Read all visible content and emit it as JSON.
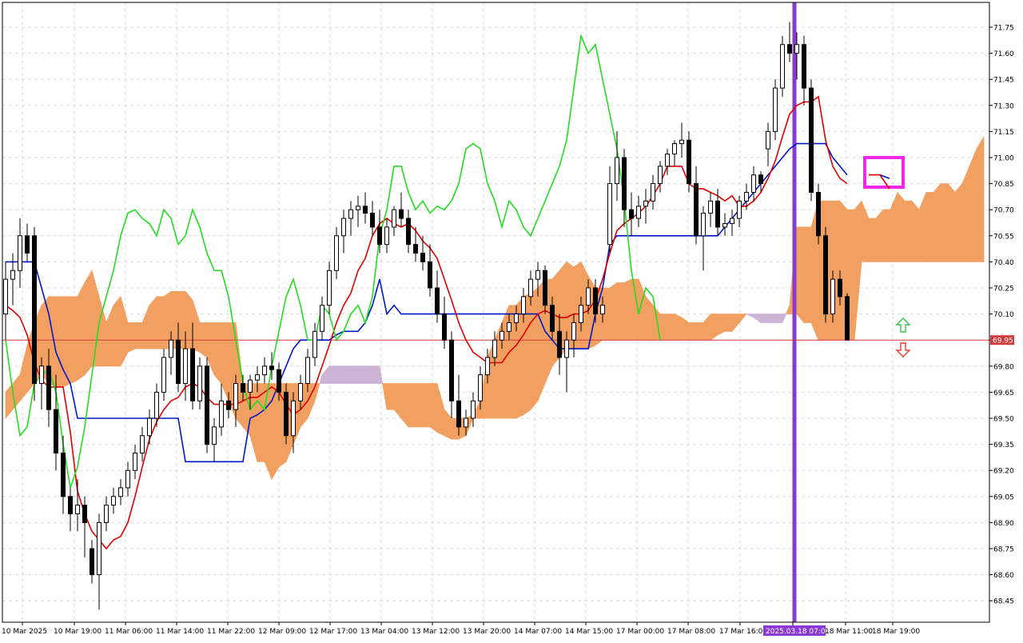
{
  "chart_data": {
    "type": "candlestick",
    "y_axis": {
      "ticks": [
        "71.75",
        "71.60",
        "71.45",
        "71.30",
        "71.15",
        "71.00",
        "70.85",
        "70.70",
        "70.55",
        "70.40",
        "70.25",
        "70.10",
        "69.95",
        "69.80",
        "69.65",
        "69.50",
        "69.35",
        "69.20",
        "69.05",
        "68.90",
        "68.75",
        "68.60",
        "68.45"
      ]
    },
    "x_axis": {
      "labels": [
        "10 Mar 2025",
        "10 Mar 19:00",
        "11 Mar 06:00",
        "11 Mar 14:00",
        "11 Mar 22:00",
        "12 Mar 09:00",
        "12 Mar 17:00",
        "13 Mar 04:00",
        "13 Mar 12:00",
        "13 Mar 20:00",
        "14 Mar 07:00",
        "14 Mar 15:00",
        "17 Mar 00:00",
        "17 Mar 08:00",
        "17 Mar 16:00",
        "2025.03.18 07:00",
        "18 Mar 11:00",
        "18 Mar 19:00"
      ]
    },
    "current_price": {
      "label": "69.95",
      "value": 69.95,
      "color": "#d23c3c"
    },
    "vertical_marker": {
      "label": "2025.03.18 07:00",
      "color": "#8a3ad4"
    },
    "colors": {
      "bull_body": "#ffffff",
      "bear_body": "#000000",
      "wick": "#000000",
      "tenkan": "#e00000",
      "kijun": "#0018c8",
      "chikou": "#22dd22",
      "cloud_bull": "#f2a061",
      "cloud_bear": "#cdb4d6",
      "overlap_line": "#e8609a",
      "overlap_kijun": "#2060c0",
      "highlight_box": "#f026e8",
      "grid": "#d9d9d9",
      "arrow_up": "#33c24a",
      "arrow_down": "#ea3b30"
    },
    "candles": [
      [
        70.1,
        70.4,
        69.95,
        70.3
      ],
      [
        70.3,
        70.45,
        70.15,
        70.35
      ],
      [
        70.35,
        70.65,
        70.25,
        70.55
      ],
      [
        70.55,
        70.62,
        70.4,
        70.45
      ],
      [
        70.55,
        70.6,
        69.6,
        69.7
      ],
      [
        69.7,
        69.85,
        69.55,
        69.8
      ],
      [
        69.8,
        69.9,
        69.45,
        69.55
      ],
      [
        69.55,
        69.75,
        69.2,
        69.3
      ],
      [
        69.3,
        69.4,
        68.95,
        69.05
      ],
      [
        69.05,
        69.1,
        68.85,
        68.95
      ],
      [
        68.95,
        69.15,
        68.85,
        69.0
      ],
      [
        69.0,
        69.05,
        68.7,
        68.9
      ],
      [
        68.75,
        68.8,
        68.55,
        68.6
      ],
      [
        68.6,
        68.95,
        68.4,
        68.9
      ],
      [
        68.9,
        69.05,
        68.85,
        69.0
      ],
      [
        69.0,
        69.1,
        68.95,
        69.05
      ],
      [
        69.05,
        69.15,
        69.0,
        69.1
      ],
      [
        69.1,
        69.25,
        69.05,
        69.2
      ],
      [
        69.2,
        69.35,
        69.15,
        69.3
      ],
      [
        69.3,
        69.45,
        69.25,
        69.4
      ],
      [
        69.4,
        69.55,
        69.35,
        69.5
      ],
      [
        69.5,
        69.7,
        69.45,
        69.65
      ],
      [
        69.65,
        69.9,
        69.6,
        69.85
      ],
      [
        69.85,
        70.0,
        69.75,
        69.95
      ],
      [
        69.95,
        70.05,
        69.65,
        69.7
      ],
      [
        69.7,
        70.0,
        69.6,
        69.9
      ],
      [
        69.9,
        70.05,
        69.55,
        69.6
      ],
      [
        69.6,
        69.85,
        69.55,
        69.8
      ],
      [
        69.8,
        69.85,
        69.3,
        69.35
      ],
      [
        69.35,
        69.5,
        69.25,
        69.45
      ],
      [
        69.45,
        69.7,
        69.4,
        69.6
      ],
      [
        69.6,
        69.65,
        69.5,
        69.55
      ],
      [
        69.55,
        69.75,
        69.45,
        69.7
      ],
      [
        69.7,
        69.75,
        69.6,
        69.65
      ],
      [
        69.65,
        69.75,
        69.55,
        69.72
      ],
      [
        69.72,
        69.8,
        69.65,
        69.75
      ],
      [
        69.75,
        69.85,
        69.7,
        69.8
      ],
      [
        69.8,
        69.88,
        69.72,
        69.78
      ],
      [
        69.78,
        69.82,
        69.6,
        69.65
      ],
      [
        69.65,
        69.7,
        69.35,
        69.4
      ],
      [
        69.4,
        69.65,
        69.3,
        69.6
      ],
      [
        69.6,
        69.75,
        69.55,
        69.7
      ],
      [
        69.7,
        69.9,
        69.65,
        69.85
      ],
      [
        69.85,
        70.05,
        69.8,
        70.0
      ],
      [
        70.0,
        70.2,
        69.95,
        70.15
      ],
      [
        70.15,
        70.4,
        70.1,
        70.35
      ],
      [
        70.35,
        70.6,
        70.3,
        70.55
      ],
      [
        70.55,
        70.7,
        70.45,
        70.65
      ],
      [
        70.65,
        70.75,
        70.55,
        70.7
      ],
      [
        70.7,
        70.78,
        70.6,
        70.72
      ],
      [
        70.72,
        70.8,
        70.62,
        70.68
      ],
      [
        70.68,
        70.75,
        70.55,
        70.6
      ],
      [
        70.6,
        70.7,
        70.45,
        70.5
      ],
      [
        70.5,
        70.65,
        70.45,
        70.6
      ],
      [
        70.6,
        70.72,
        70.55,
        70.7
      ],
      [
        70.7,
        70.8,
        70.6,
        70.65
      ],
      [
        70.65,
        70.7,
        70.45,
        70.5
      ],
      [
        70.5,
        70.6,
        70.4,
        70.45
      ],
      [
        70.45,
        70.55,
        70.35,
        70.4
      ],
      [
        70.4,
        70.5,
        70.2,
        70.25
      ],
      [
        70.25,
        70.35,
        70.05,
        70.1
      ],
      [
        70.1,
        70.2,
        69.9,
        69.95
      ],
      [
        69.95,
        70.0,
        69.5,
        69.6
      ],
      [
        69.6,
        69.75,
        69.4,
        69.45
      ],
      [
        69.45,
        69.55,
        69.4,
        69.5
      ],
      [
        69.5,
        69.65,
        69.45,
        69.6
      ],
      [
        69.6,
        69.8,
        69.55,
        69.75
      ],
      [
        69.75,
        69.9,
        69.7,
        69.85
      ],
      [
        69.85,
        70.0,
        69.8,
        69.95
      ],
      [
        69.95,
        70.05,
        69.9,
        70.0
      ],
      [
        70.0,
        70.1,
        69.95,
        70.05
      ],
      [
        70.05,
        70.15,
        70.0,
        70.1
      ],
      [
        70.1,
        70.25,
        70.05,
        70.2
      ],
      [
        70.2,
        70.35,
        70.15,
        70.3
      ],
      [
        70.3,
        70.4,
        70.2,
        70.35
      ],
      [
        70.35,
        70.38,
        70.1,
        70.15
      ],
      [
        70.15,
        70.2,
        69.95,
        70.0
      ],
      [
        70.0,
        70.1,
        69.75,
        69.85
      ],
      [
        69.85,
        70.0,
        69.65,
        69.95
      ],
      [
        69.95,
        70.1,
        69.85,
        70.05
      ],
      [
        70.05,
        70.2,
        70.0,
        70.15
      ],
      [
        70.15,
        70.3,
        70.1,
        70.25
      ],
      [
        70.25,
        70.3,
        70.05,
        70.1
      ],
      [
        70.1,
        70.2,
        70.05,
        70.15
      ],
      [
        70.5,
        70.95,
        70.45,
        70.85
      ],
      [
        70.85,
        71.15,
        70.75,
        71.0
      ],
      [
        71.0,
        71.05,
        70.6,
        70.7
      ],
      [
        70.7,
        70.8,
        70.55,
        70.65
      ],
      [
        70.65,
        70.78,
        70.6,
        70.72
      ],
      [
        70.72,
        70.82,
        70.62,
        70.75
      ],
      [
        70.75,
        70.9,
        70.7,
        70.85
      ],
      [
        70.85,
        70.98,
        70.8,
        70.95
      ],
      [
        70.95,
        71.05,
        70.9,
        71.02
      ],
      [
        71.02,
        71.1,
        70.95,
        71.08
      ],
      [
        71.08,
        71.2,
        71.0,
        71.1
      ],
      [
        71.1,
        71.15,
        70.8,
        70.85
      ],
      [
        70.85,
        70.95,
        70.5,
        70.55
      ],
      [
        70.55,
        70.72,
        70.35,
        70.68
      ],
      [
        70.68,
        70.8,
        70.6,
        70.75
      ],
      [
        70.75,
        70.82,
        70.55,
        70.6
      ],
      [
        70.6,
        70.68,
        70.55,
        70.62
      ],
      [
        70.62,
        70.7,
        70.55,
        70.65
      ],
      [
        70.65,
        70.78,
        70.6,
        70.75
      ],
      [
        70.75,
        70.85,
        70.7,
        70.8
      ],
      [
        70.8,
        70.95,
        70.75,
        70.9
      ],
      [
        70.9,
        70.92,
        70.8,
        70.85
      ],
      [
        71.05,
        71.2,
        70.95,
        71.15
      ],
      [
        71.15,
        71.45,
        71.1,
        71.4
      ],
      [
        71.4,
        71.7,
        71.35,
        71.65
      ],
      [
        71.65,
        71.78,
        71.55,
        71.6
      ],
      [
        71.6,
        71.72,
        71.45,
        71.65
      ],
      [
        71.65,
        71.7,
        71.3,
        71.4
      ],
      [
        71.4,
        71.45,
        70.75,
        70.8
      ],
      [
        70.8,
        70.85,
        70.5,
        70.55
      ],
      [
        70.55,
        70.6,
        70.05,
        70.1
      ],
      [
        70.1,
        70.35,
        70.05,
        70.3
      ],
      [
        70.3,
        70.35,
        70.15,
        70.2
      ],
      [
        70.2,
        70.22,
        69.95,
        69.95
      ]
    ],
    "tenkan": [
      70.15,
      70.12,
      70.08,
      69.98,
      69.82,
      69.72,
      69.68,
      69.68,
      69.68,
      69.42,
      69.08,
      68.95,
      68.85,
      68.8,
      68.75,
      68.8,
      68.82,
      68.9,
      69.05,
      69.22,
      69.38,
      69.48,
      69.55,
      69.6,
      69.62,
      69.68,
      69.7,
      69.68,
      69.62,
      69.58,
      69.58,
      69.58,
      69.58,
      69.6,
      69.62,
      69.62,
      69.65,
      69.68,
      69.65,
      69.58,
      69.52,
      69.55,
      69.6,
      69.68,
      69.8,
      69.92,
      70.05,
      70.15,
      70.22,
      70.35,
      70.42,
      70.55,
      70.62,
      70.65,
      70.62,
      70.6,
      70.62,
      70.58,
      70.52,
      70.48,
      70.42,
      70.3,
      70.18,
      70.05,
      69.95,
      69.88,
      69.85,
      69.82,
      69.82,
      69.82,
      69.88,
      69.92,
      69.98,
      70.05,
      70.1,
      70.12,
      70.1,
      70.08,
      70.08,
      70.1,
      70.1,
      70.12,
      70.18,
      70.3,
      70.45,
      70.58,
      70.62,
      70.65,
      70.68,
      70.72,
      70.78,
      70.85,
      70.95,
      70.95,
      70.95,
      70.85,
      70.82,
      70.82,
      70.8,
      70.78,
      70.75,
      70.78,
      70.72,
      70.72,
      70.75,
      70.8,
      70.88,
      70.98,
      71.12,
      71.25,
      71.3,
      71.32,
      71.32,
      71.35,
      71.1,
      70.95,
      70.88,
      70.85
    ],
    "kijun": [
      70.4,
      70.4,
      70.4,
      70.4,
      70.4,
      70.25,
      70.1,
      69.88,
      69.78,
      69.7,
      69.5,
      69.5,
      69.5,
      69.5,
      69.5,
      69.5,
      69.5,
      69.5,
      69.5,
      69.5,
      69.5,
      69.5,
      69.5,
      69.5,
      69.5,
      69.25,
      69.25,
      69.25,
      69.25,
      69.25,
      69.25,
      69.25,
      69.25,
      69.25,
      69.5,
      69.52,
      69.55,
      69.6,
      69.7,
      69.8,
      69.9,
      69.95,
      69.95,
      69.95,
      69.95,
      69.95,
      69.98,
      70.0,
      70.0,
      70.0,
      70.05,
      70.15,
      70.3,
      70.1,
      70.15,
      70.1,
      70.1,
      70.1,
      70.1,
      70.1,
      70.1,
      70.1,
      70.1,
      70.1,
      70.1,
      70.1,
      70.1,
      70.1,
      70.1,
      70.1,
      70.1,
      70.1,
      70.1,
      70.1,
      70.1,
      70.0,
      69.95,
      69.9,
      69.9,
      69.9,
      69.9,
      69.9,
      70.1,
      70.25,
      70.5,
      70.55,
      70.55,
      70.55,
      70.55,
      70.55,
      70.55,
      70.55,
      70.55,
      70.55,
      70.55,
      70.55,
      70.55,
      70.55,
      70.55,
      70.55,
      70.6,
      70.65,
      70.7,
      70.75,
      70.8,
      70.85,
      70.9,
      70.95,
      71.0,
      71.05,
      71.08,
      71.08,
      71.08,
      71.08,
      71.08,
      71.0,
      70.95,
      70.9
    ],
    "chikou": [
      69.95,
      69.65,
      69.4,
      69.45,
      69.7,
      69.75,
      69.78,
      69.65,
      69.35,
      69.1,
      69.22,
      69.45,
      69.75,
      70.05,
      70.2,
      70.35,
      70.55,
      70.68,
      70.7,
      70.65,
      70.62,
      70.55,
      70.7,
      70.65,
      70.5,
      70.55,
      70.7,
      70.6,
      70.45,
      70.35,
      70.35,
      70.2,
      69.95,
      69.7,
      69.55,
      69.6,
      69.55,
      69.8,
      70.0,
      70.2,
      70.3,
      70.15,
      69.95,
      69.95,
      70.15,
      70.1,
      69.95,
      70.0,
      70.1,
      70.15,
      70.05,
      70.2,
      70.55,
      70.7,
      70.95,
      70.95,
      70.8,
      70.7,
      70.75,
      70.68,
      70.72,
      70.7,
      70.75,
      70.85,
      71.05,
      71.08,
      71.05,
      70.85,
      70.75,
      70.6,
      70.75,
      70.7,
      70.6,
      70.55,
      70.65,
      70.75,
      70.85,
      70.95,
      71.1,
      71.4,
      71.7,
      71.6,
      71.65,
      71.45,
      71.25,
      71.05,
      70.75,
      70.35,
      70.1,
      70.25,
      70.2,
      69.95
    ],
    "senkou_a": [
      69.65,
      69.7,
      69.75,
      69.92,
      70.05,
      70.15,
      70.2,
      70.2,
      70.2,
      70.2,
      70.2,
      70.28,
      70.35,
      70.2,
      70.05,
      70.15,
      70.2,
      70.05,
      70.05,
      70.05,
      70.15,
      70.2,
      70.2,
      70.23,
      70.23,
      70.23,
      70.18,
      70.05,
      70.05,
      70.05,
      70.05,
      70.05,
      70.05,
      69.7,
      69.7,
      69.7,
      69.7,
      69.7,
      69.7,
      69.7,
      69.7,
      69.7,
      69.7,
      69.7,
      69.7,
      69.7,
      69.7,
      69.7,
      69.7,
      69.7,
      69.7,
      69.7,
      69.7,
      69.7,
      69.7,
      69.7,
      69.7,
      69.7,
      69.7,
      69.7,
      69.7,
      69.55,
      69.5,
      69.5,
      69.5,
      69.52,
      69.6,
      69.85,
      69.95,
      70.05,
      70.15,
      70.15,
      70.2,
      70.22,
      70.25,
      70.3,
      70.3,
      70.35,
      70.4,
      70.37,
      70.4,
      70.32,
      70.25,
      70.25,
      70.25,
      70.28,
      70.28,
      70.3,
      70.3,
      70.2,
      70.15,
      70.1,
      70.1,
      70.1,
      70.08,
      70.05,
      70.05,
      70.05,
      70.1,
      70.1,
      70.1,
      70.1,
      70.1,
      70.1,
      70.08,
      70.05,
      70.05,
      70.05,
      70.05,
      70.15,
      70.6,
      70.6,
      70.6,
      70.75,
      70.75,
      70.75,
      70.75,
      70.7,
      70.7,
      70.75,
      70.65,
      70.65,
      70.7,
      70.7,
      70.8,
      70.75,
      70.75,
      70.7,
      70.8,
      70.8,
      70.85,
      70.85,
      70.8,
      70.85,
      70.95,
      71.05,
      71.12
    ],
    "senkou_b": [
      69.5,
      69.55,
      69.6,
      69.65,
      69.7,
      69.75,
      69.7,
      69.68,
      69.68,
      69.7,
      69.72,
      69.75,
      69.8,
      69.8,
      69.8,
      69.8,
      69.8,
      69.88,
      69.9,
      69.9,
      69.9,
      69.9,
      69.9,
      69.9,
      69.9,
      69.9,
      69.9,
      69.88,
      69.85,
      69.75,
      69.7,
      69.6,
      69.5,
      69.45,
      69.4,
      69.25,
      69.25,
      69.15,
      69.22,
      69.25,
      69.35,
      69.45,
      69.5,
      69.6,
      69.75,
      69.8,
      69.8,
      69.8,
      69.8,
      69.8,
      69.8,
      69.8,
      69.8,
      69.55,
      69.55,
      69.5,
      69.45,
      69.45,
      69.45,
      69.45,
      69.42,
      69.4,
      69.38,
      69.38,
      69.4,
      69.5,
      69.5,
      69.5,
      69.5,
      69.5,
      69.5,
      69.5,
      69.52,
      69.55,
      69.6,
      69.7,
      69.8,
      69.85,
      69.9,
      69.9,
      69.9,
      69.9,
      69.92,
      69.95,
      69.95,
      69.95,
      69.95,
      69.95,
      69.95,
      69.95,
      69.95,
      69.95,
      69.95,
      69.95,
      69.95,
      69.95,
      69.95,
      69.95,
      69.95,
      69.98,
      70.0,
      70.0,
      70.05,
      70.1,
      70.1,
      70.1,
      70.1,
      70.1,
      70.1,
      70.1,
      70.1,
      70.05,
      70.05,
      69.95,
      69.95,
      69.95,
      69.95,
      69.95,
      69.95,
      70.4,
      70.4,
      70.4,
      70.4,
      70.4,
      70.4,
      70.4,
      70.4,
      70.4,
      70.4,
      70.4,
      70.4,
      70.4,
      70.4,
      70.4,
      70.4,
      70.4,
      70.4,
      70.4,
      70.4,
      70.4,
      70.4,
      70.4,
      70.45,
      70.55,
      70.65,
      70.8,
      70.9,
      71.0
    ],
    "highlight_lines": {
      "tenkan": [
        70.9,
        70.9,
        70.82
      ],
      "kijun": [
        70.9,
        70.9,
        70.88
      ]
    }
  }
}
